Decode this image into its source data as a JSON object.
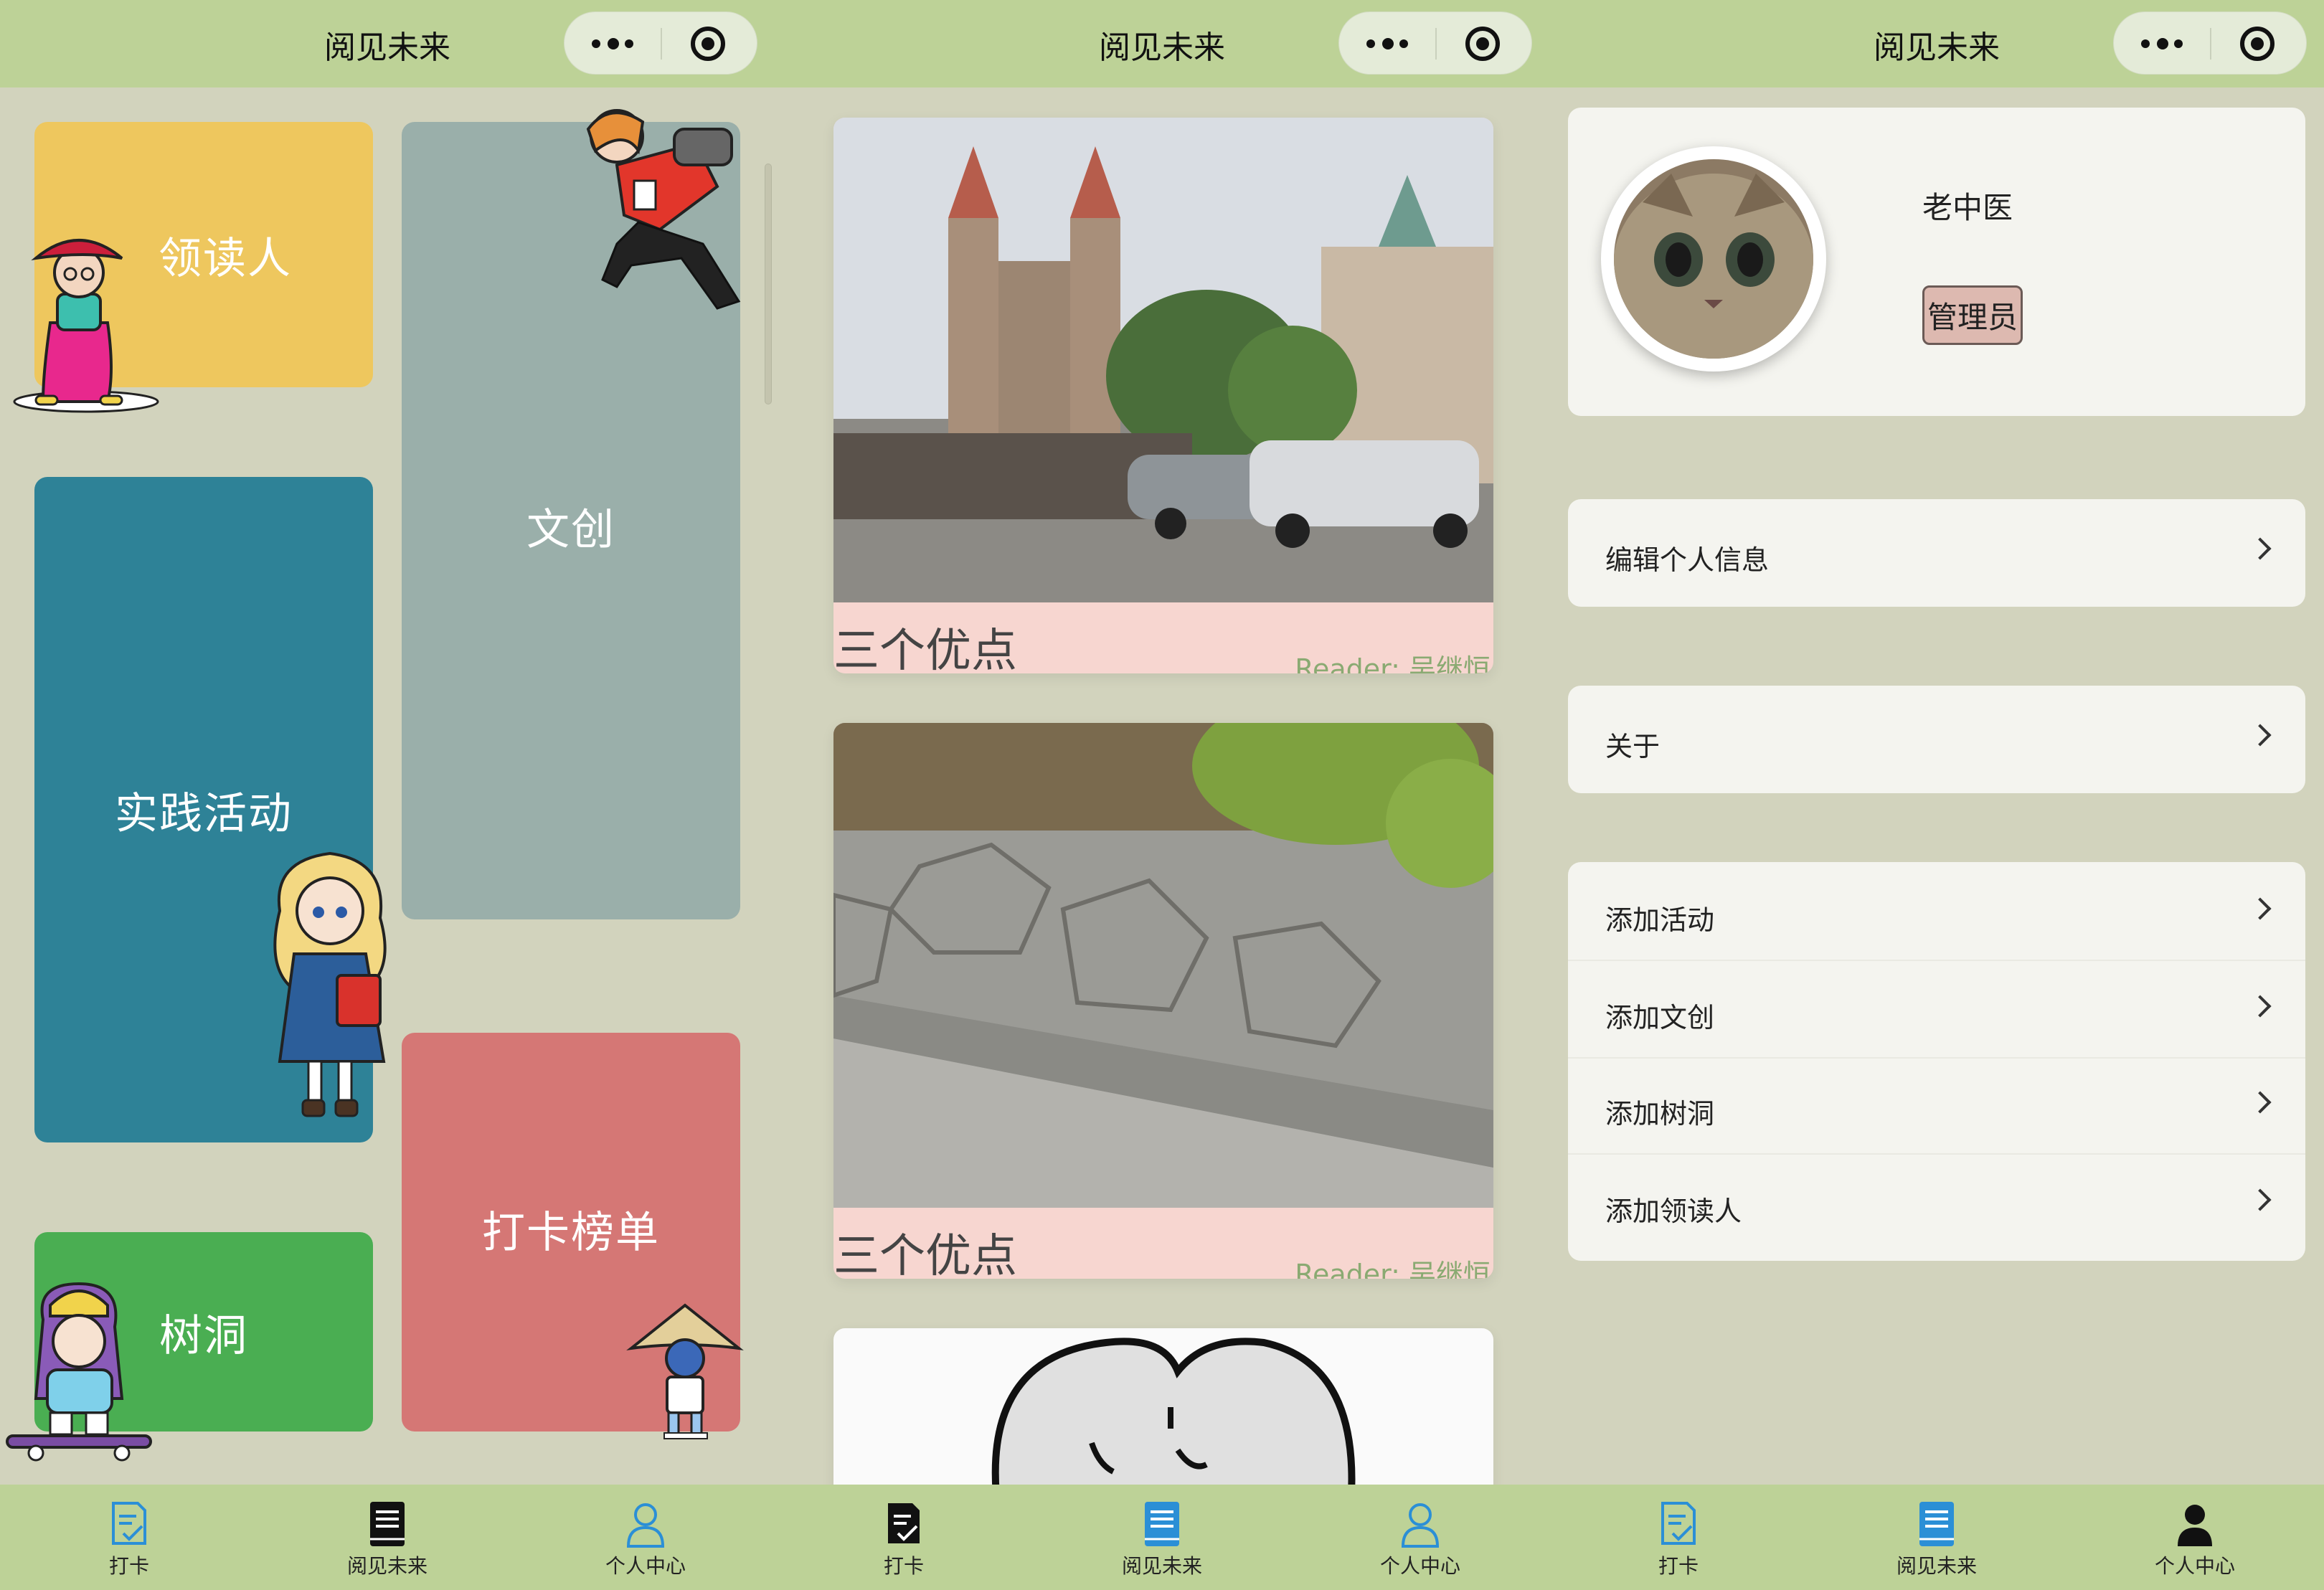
{
  "app": {
    "title": "阅见未来"
  },
  "tabs": [
    {
      "label": "打卡"
    },
    {
      "label": "阅见未来"
    },
    {
      "label": "个人中心"
    }
  ],
  "screen1": {
    "tiles": {
      "lead_reader": "领读人",
      "cultural": "文创",
      "practice": "实践活动",
      "ranking": "打卡榜单",
      "tree_hole": "树洞"
    },
    "colors": {
      "yellow": "#eec75e",
      "gray": "#9aafaa",
      "teal": "#2e8297",
      "red": "#d57775",
      "green": "#4aae52"
    }
  },
  "screen2": {
    "cards": [
      {
        "title": "三个优点",
        "reader": "Reader: 吴继恒"
      },
      {
        "title": "三个优点",
        "reader": "Reader: 吴继恒"
      }
    ]
  },
  "screen3": {
    "user": {
      "name": "老中医",
      "role": "管理员"
    },
    "menu_single": [
      {
        "label": "编辑个人信息"
      },
      {
        "label": "关于"
      }
    ],
    "menu_admin": [
      {
        "label": "添加活动"
      },
      {
        "label": "添加文创"
      },
      {
        "label": "添加树洞"
      },
      {
        "label": "添加领读人"
      }
    ]
  }
}
